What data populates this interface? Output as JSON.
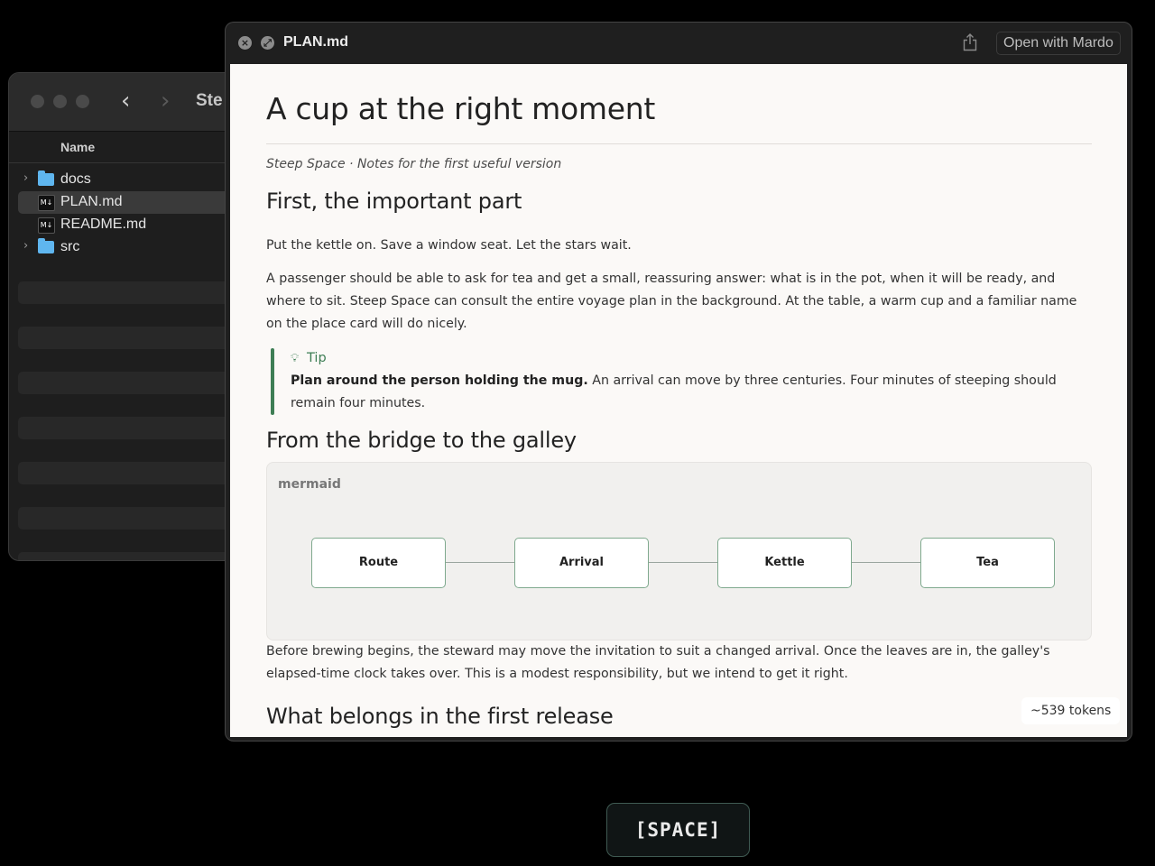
{
  "finder": {
    "title": "Ste",
    "column_header": "Name",
    "files": [
      {
        "name": "docs",
        "type": "folder",
        "expandable": true,
        "selected": false
      },
      {
        "name": "PLAN.md",
        "type": "markdown",
        "expandable": false,
        "selected": true
      },
      {
        "name": "README.md",
        "type": "markdown",
        "expandable": false,
        "selected": false
      },
      {
        "name": "src",
        "type": "folder",
        "expandable": true,
        "selected": false
      }
    ],
    "md_icon_label": "M↓"
  },
  "preview": {
    "title": "PLAN.md",
    "open_with": "Open with Mardo",
    "doc": {
      "title": "A cup at the right moment",
      "subtitle": "Steep Space · Notes for the first useful version",
      "section1": "First, the important part",
      "para1": "Put the kettle on. Save a window seat. Let the stars wait.",
      "para2": "A passenger should be able to ask for tea and get a small, reassuring answer: what is in the pot, when it will be ready, and where to sit. Steep Space can consult the entire voyage plan in the background. At the table, a warm cup and a familiar name on the place card will do nicely.",
      "tip_label": "Tip",
      "tip_bold": "Plan around the person holding the mug.",
      "tip_text": " An arrival can move by three centuries. Four minutes of steeping should remain four minutes.",
      "section2": "From the bridge to the galley",
      "mermaid_label": "mermaid",
      "flow_nodes": [
        "Route",
        "Arrival",
        "Kettle",
        "Tea"
      ],
      "para3": "Before brewing begins, the steward may move the invitation to suit a changed arrival. Once the leaves are in, the galley's elapsed-time clock takes over. This is a modest responsibility, but we intend to get it right.",
      "section3": "What belongs in the first release"
    },
    "tokens": "~539 tokens"
  },
  "space_key": "[SPACE]",
  "colors": {
    "accent_green": "#3e7e55",
    "folder_blue": "#5fb6ef",
    "doc_background": "#fbf9f7"
  }
}
